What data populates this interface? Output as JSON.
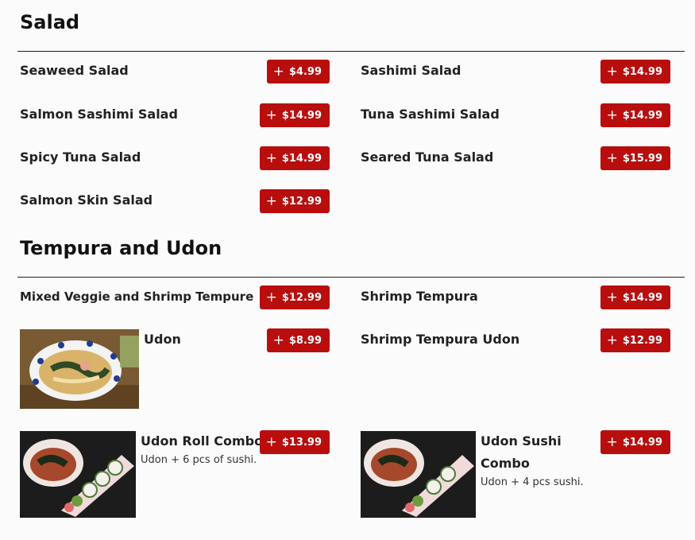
{
  "sections": [
    {
      "title": "Salad",
      "items": [
        {
          "name": "Seaweed Salad",
          "price": "$4.99"
        },
        {
          "name": "Sashimi Salad",
          "price": "$14.99"
        },
        {
          "name": "Salmon Sashimi Salad",
          "price": "$14.99"
        },
        {
          "name": "Tuna Sashimi Salad",
          "price": "$14.99"
        },
        {
          "name": "Spicy Tuna Salad",
          "price": "$14.99"
        },
        {
          "name": "Seared Tuna Salad",
          "price": "$15.99"
        },
        {
          "name": "Salmon Skin Salad",
          "price": "$12.99"
        }
      ]
    },
    {
      "title": "Tempura and Udon",
      "items": [
        {
          "name": "Mixed Veggie and Shrimp Tempure",
          "price": "$12.99"
        },
        {
          "name": "Shrimp Tempura",
          "price": "$14.99"
        },
        {
          "name": "Udon",
          "price": "$8.99",
          "image": "udon-bowl-photo"
        },
        {
          "name": "Shrimp Tempura Udon",
          "price": "$12.99"
        },
        {
          "name": "Udon Roll Combo",
          "price": "$13.99",
          "description": "Udon + 6 pcs of sushi.",
          "image": "udon-roll-combo-photo"
        },
        {
          "name": "Udon Sushi Combo",
          "price": "$14.99",
          "description": "Udon + 4 pcs sushi.",
          "image": "udon-sushi-combo-photo"
        }
      ]
    }
  ],
  "icons": {
    "add": "plus-icon"
  },
  "colors": {
    "price_button": "#b80e0e",
    "divider": "#222222"
  }
}
